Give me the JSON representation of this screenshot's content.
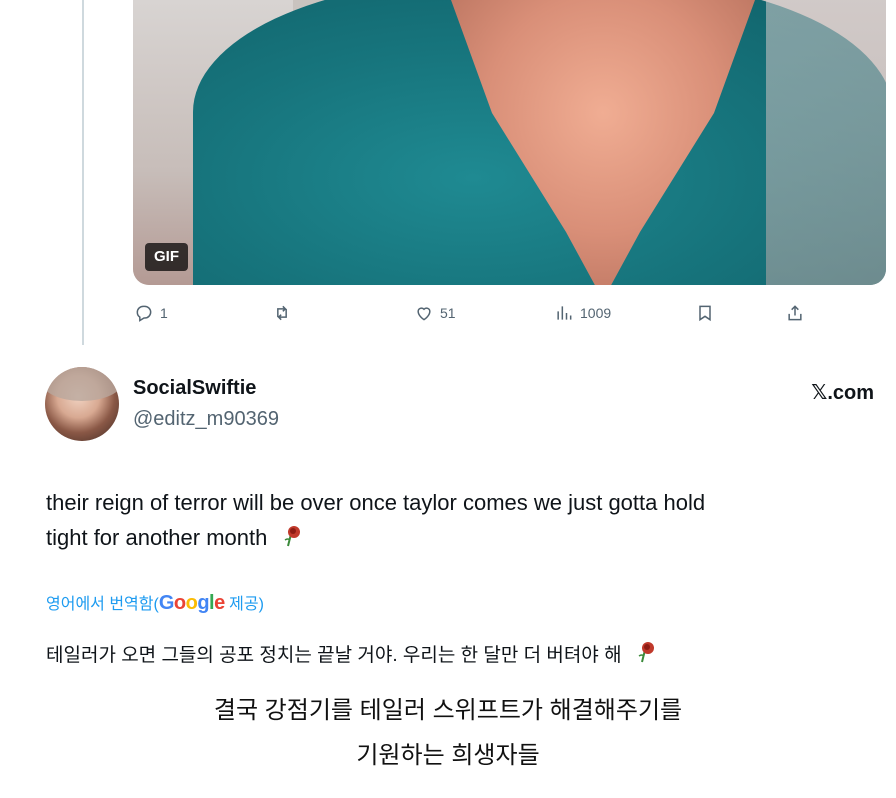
{
  "media": {
    "badge": "GIF"
  },
  "actions": {
    "replies": "1",
    "likes": "51",
    "views": "1009"
  },
  "author": {
    "name": "SocialSwiftie",
    "handle": "@editz_m90369"
  },
  "source": "𝕏.com",
  "tweet": {
    "line1": "their reign of terror will be over once taylor comes we just gotta hold",
    "line2": "tight for another month"
  },
  "translation": {
    "prefix": "영어에서 번역함(",
    "brand_letters": [
      "G",
      "o",
      "o",
      "g",
      "l",
      "e"
    ],
    "suffix": " 제공)",
    "text": "테일러가 오면 그들의 공포 정치는 끝날 거야. 우리는 한 달만 더 버텨야 해"
  },
  "caption": {
    "line1": "결국 강점기를 테일러 스위프트가 해결해주기를",
    "line2": "기원하는 희생자들"
  },
  "colors": {
    "accent": "#1d9bf0",
    "muted": "#536471",
    "text": "#0f1419"
  },
  "icons": [
    "reply-icon",
    "retweet-icon",
    "like-icon",
    "views-icon",
    "bookmark-icon",
    "share-icon",
    "rose-emoji"
  ]
}
